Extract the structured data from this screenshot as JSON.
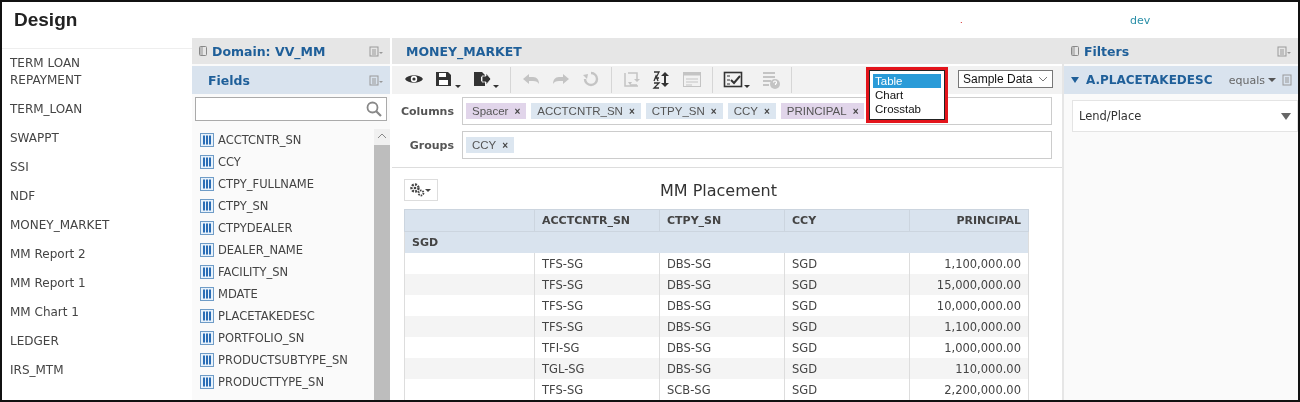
{
  "header": {
    "title": "Design",
    "mark": ".",
    "environment": "dev"
  },
  "reports": [
    "TERM LOAN REPAYMENT",
    "TERM_LOAN",
    "SWAPPT",
    "SSI",
    "NDF",
    "MONEY_MARKET",
    "MM Report 2",
    "MM Report 1",
    "MM Chart 1",
    "LEDGER",
    "IRS_MTM"
  ],
  "domain": {
    "title": "Domain: VV_MM",
    "fields_title": "Fields",
    "fields": [
      "ACCTCNTR_SN",
      "CCY",
      "CTPY_FULLNAME",
      "CTPY_SN",
      "CTPYDEALER",
      "DEALER_NAME",
      "FACILITY_SN",
      "MDATE",
      "PLACETAKEDESC",
      "PORTFOLIO_SN",
      "PRODUCTSUBTYPE_SN",
      "PRODUCTTYPE_SN"
    ]
  },
  "editor": {
    "title": "MONEY_MARKET",
    "toolbar": [
      {
        "kind": "eye",
        "disabled": false,
        "caret": false
      },
      {
        "kind": "save",
        "disabled": false,
        "caret": true
      },
      {
        "kind": "export",
        "disabled": false,
        "caret": true
      },
      {
        "kind": "sep"
      },
      {
        "kind": "undo",
        "disabled": true,
        "caret": false
      },
      {
        "kind": "redo",
        "disabled": true,
        "caret": false
      },
      {
        "kind": "reset",
        "disabled": true,
        "caret": false
      },
      {
        "kind": "sep"
      },
      {
        "kind": "swap",
        "disabled": true,
        "caret": false
      },
      {
        "kind": "sort",
        "disabled": false,
        "caret": false
      },
      {
        "kind": "form",
        "disabled": true,
        "caret": false
      },
      {
        "kind": "sep"
      },
      {
        "kind": "check",
        "disabled": false,
        "caret": true
      },
      {
        "kind": "help",
        "disabled": true,
        "caret": false
      },
      {
        "kind": "sep"
      }
    ],
    "view_options": [
      {
        "label": "Table",
        "selected": true
      },
      {
        "label": "Chart",
        "selected": false
      },
      {
        "label": "Crosstab",
        "selected": false
      }
    ],
    "data_mode": "Sample Data",
    "columns_label": "Columns",
    "columns": [
      {
        "label": "Spacer",
        "color": "#e1d5ea"
      },
      {
        "label": "ACCTCNTR_SN",
        "color": "#dce6f0"
      },
      {
        "label": "CTPY_SN",
        "color": "#dce6f0"
      },
      {
        "label": "CCY",
        "color": "#dce6f0"
      },
      {
        "label": "PRINCIPAL",
        "color": "#e1d5ea"
      }
    ],
    "groups_label": "Groups",
    "groups": [
      {
        "label": "CCY",
        "color": "#dce6f0"
      }
    ],
    "chip_remove": "×",
    "report_title": "MM Placement",
    "table": {
      "columns": [
        "",
        "ACCTCNTR_SN",
        "CTPY_SN",
        "CCY",
        "PRINCIPAL"
      ],
      "group": "SGD",
      "rows": [
        [
          "",
          "TFS-SG",
          "DBS-SG",
          "SGD",
          "1,100,000.00"
        ],
        [
          "",
          "TFS-SG",
          "DBS-SG",
          "SGD",
          "15,000,000.00"
        ],
        [
          "",
          "TFS-SG",
          "DBS-SG",
          "SGD",
          "10,000,000.00"
        ],
        [
          "",
          "TFS-SG",
          "DBS-SG",
          "SGD",
          "1,100,000.00"
        ],
        [
          "",
          "TFI-SG",
          "DBS-SG",
          "SGD",
          "1,000,000.00"
        ],
        [
          "",
          "TGL-SG",
          "DBS-SG",
          "SGD",
          "110,000.00"
        ],
        [
          "",
          "TFS-SG",
          "SCB-SG",
          "SGD",
          "2,200,000.00"
        ]
      ]
    }
  },
  "filters": {
    "title": "Filters",
    "field": "A.PLACETAKEDESC",
    "operator": "equals",
    "value": "Lend/Place"
  }
}
